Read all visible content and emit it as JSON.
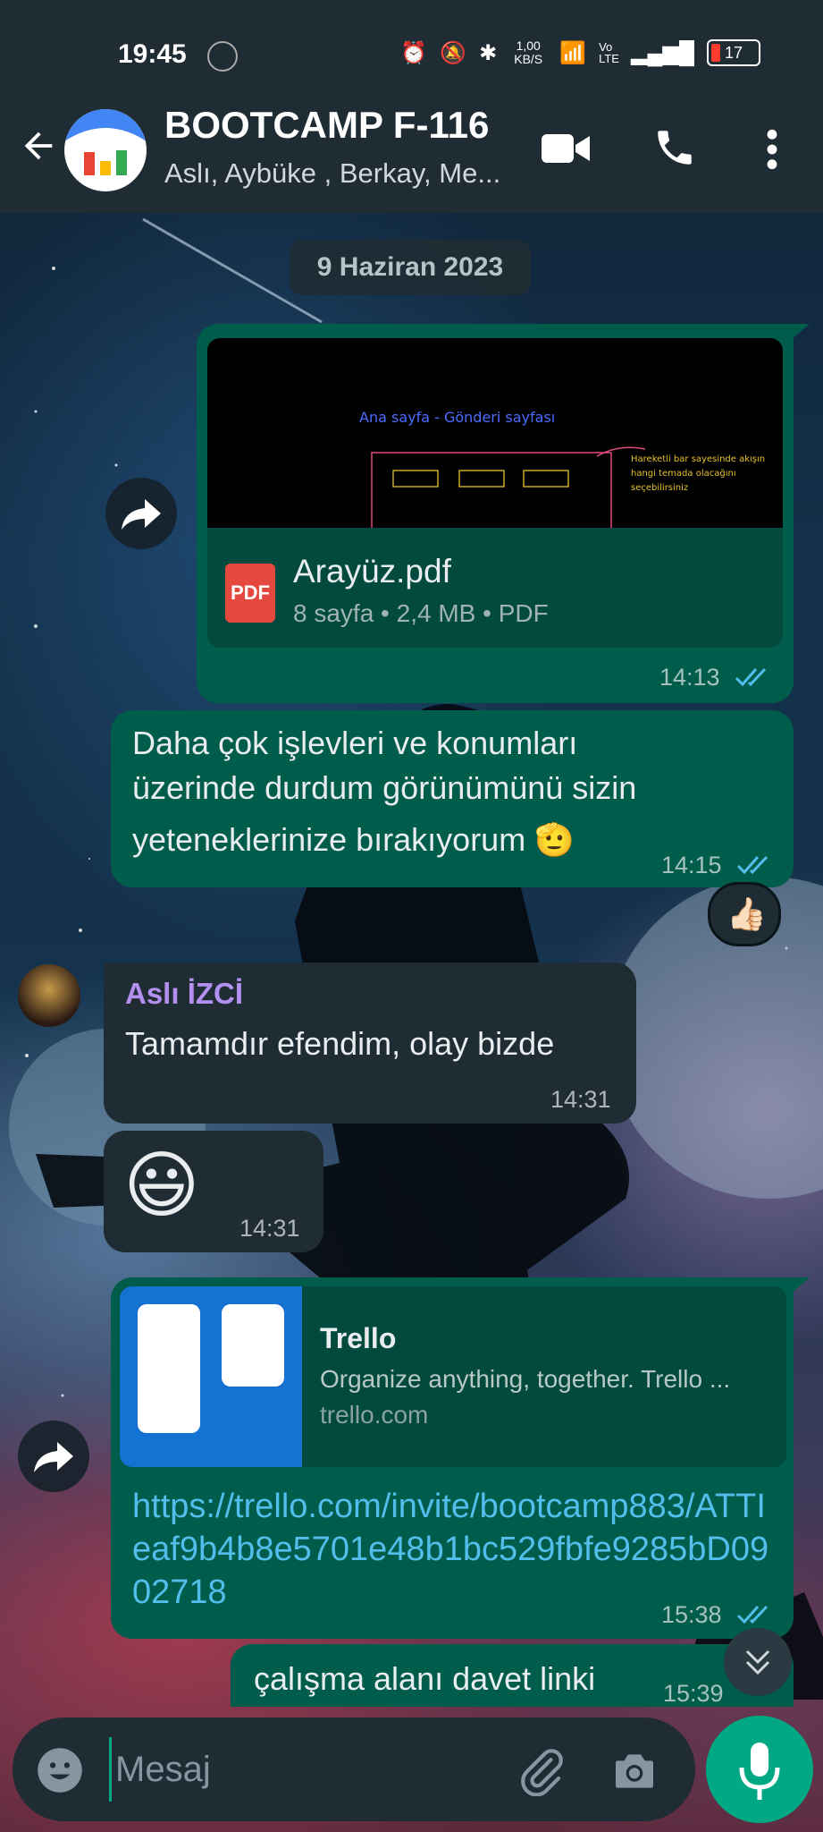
{
  "status_bar": {
    "time": "19:45",
    "network_speed": "1,00 KB/S",
    "network_type": "Vo LTE",
    "battery": "17"
  },
  "header": {
    "title": "BOOTCAMP F-116",
    "members": "Aslı, Aybüke , Berkay, Me..."
  },
  "date_chip": "9 Haziran 2023",
  "messages": [
    {
      "type": "document",
      "file_name": "Arayüz.pdf",
      "meta": "8 sayfa • 2,4 MB • PDF",
      "time": "14:13",
      "icon": "pdf-icon",
      "preview_text": [
        "Ana sayfa - Gönderi sayfası",
        "Hareketli bar sayesinde akışın hangi temada olacağını seçebilirsiniz"
      ]
    },
    {
      "type": "text_out",
      "lines": [
        "Daha çok işlevleri ve konumları",
        "üzerinde durdum görünümünü sizin",
        "yeteneklerinize bırakıyorum 🫡"
      ],
      "time": "14:15",
      "reaction": "👍🏻"
    },
    {
      "type": "text_in",
      "sender": "Aslı İZCİ",
      "text": "Tamamdır efendim, olay bizde",
      "time": "14:31"
    },
    {
      "type": "emoji_in",
      "text": "😃",
      "time": "14:31"
    },
    {
      "type": "link",
      "card_title": "Trello",
      "card_desc": "Organize anything, together. Trello ...",
      "card_domain": "trello.com",
      "url": "https://trello.com/invite/bootcamp883/ATTIeaf9b4b8e5701e48b1bc529fbfe9285bD0902718",
      "time": "15:38"
    },
    {
      "type": "text_out_partial",
      "text": "çalışma alanı davet linki",
      "time": "15:39"
    }
  ],
  "composer": {
    "placeholder": "Mesaj"
  },
  "colors": {
    "outgoing": "#005c4b",
    "incoming": "#1f2c34",
    "accent": "#00a884",
    "sender_name": "#b38ff0",
    "link": "#53bdeb"
  }
}
